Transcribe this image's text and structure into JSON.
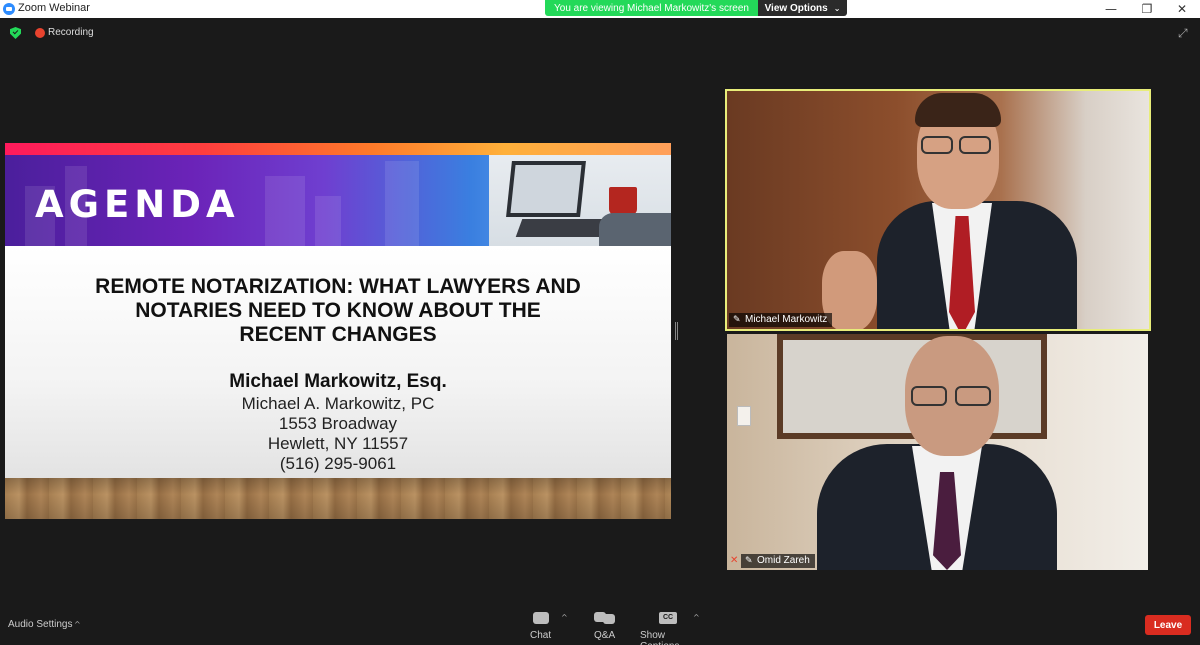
{
  "window": {
    "title": "Zoom Webinar",
    "controls": [
      "minimize",
      "restore",
      "close"
    ]
  },
  "banner": {
    "viewing_text": "You are viewing Michael Markowitz's screen",
    "view_options_label": "View Options"
  },
  "status": {
    "recording_label": "Recording",
    "security_icon": "shield-check-icon"
  },
  "slide": {
    "agenda_heading": "AGENDA",
    "title_lines": [
      "REMOTE NOTARIZATION: WHAT LAWYERS AND",
      "NOTARIES NEED TO KNOW ABOUT THE",
      "RECENT CHANGES"
    ],
    "presenter_name": "Michael Markowitz, Esq.",
    "firm": "Michael A. Markowitz, PC",
    "address_line1": "1553 Broadway",
    "address_line2": "Hewlett, NY 11557",
    "phone": "(516) 295-9061"
  },
  "participants": [
    {
      "name": "Michael Markowitz",
      "active_speaker": true,
      "muted": false
    },
    {
      "name": "Omid Zareh",
      "active_speaker": false,
      "muted": true
    }
  ],
  "toolbar": {
    "audio_settings_label": "Audio Settings",
    "chat_label": "Chat",
    "qa_label": "Q&A",
    "captions_label": "Show Captions",
    "captions_badge": "CC",
    "leave_label": "Leave"
  },
  "colors": {
    "banner_green": "#23d959",
    "active_speaker_border": "#e8ed7a",
    "leave_red": "#d92c20",
    "recording_red": "#e8432e"
  }
}
